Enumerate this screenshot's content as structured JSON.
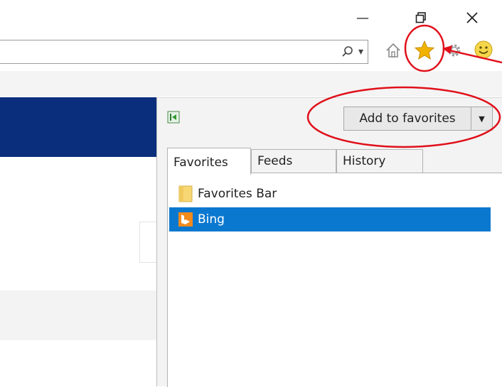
{
  "window": {
    "minimize_glyph": "—",
    "restore_glyph": "❐",
    "close_glyph": "✕"
  },
  "toolbar": {
    "search_icon": "search-icon",
    "dropdown_glyph": "▾",
    "home_icon": "home-icon",
    "favorites_icon": "star-icon",
    "tools_icon": "gear-icon",
    "feedback_icon": "smiley-icon"
  },
  "favorites_panel": {
    "add_button_label": "Add to favorites",
    "add_dropdown_glyph": "▼",
    "tabs": [
      {
        "label": "Favorites",
        "active": true
      },
      {
        "label": "Feeds",
        "active": false
      },
      {
        "label": "History",
        "active": false
      }
    ],
    "items": [
      {
        "label": "Favorites Bar",
        "icon": "folder-icon",
        "selected": false
      },
      {
        "label": "Bing",
        "icon": "bing-icon",
        "selected": true
      }
    ]
  },
  "colors": {
    "page_banner": "#0b2e7c",
    "selection": "#0b78d0",
    "annotation_red": "#e0101a",
    "star": "#f2b300"
  }
}
